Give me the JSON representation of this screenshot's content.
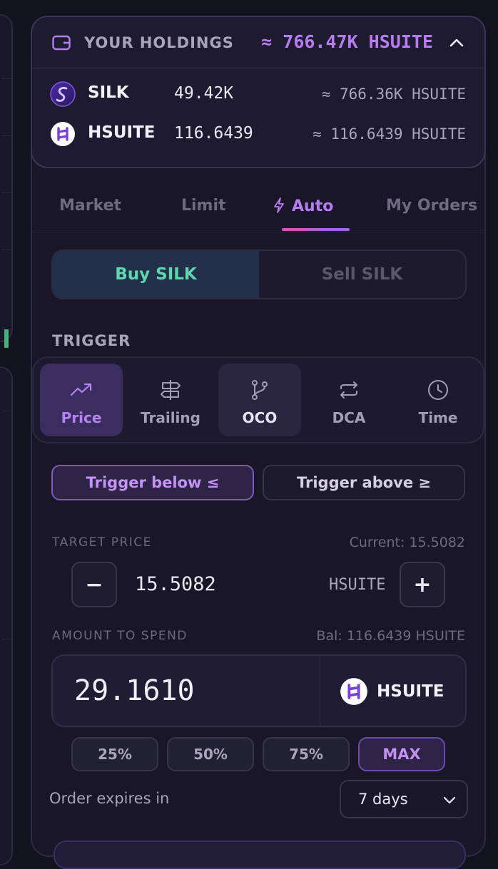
{
  "holdings": {
    "title": "YOUR HOLDINGS",
    "total": "≈ 766.47K HSUITE",
    "assets": [
      {
        "name": "SILK",
        "amount": "49.42K",
        "value": "≈ 766.36K HSUITE",
        "icon": "silk-logo-icon"
      },
      {
        "name": "HSUITE",
        "amount": "116.6439",
        "value": "≈ 116.6439 HSUITE",
        "icon": "hsuite-logo-icon"
      }
    ]
  },
  "tabs": [
    {
      "label": "Market"
    },
    {
      "label": "Limit"
    },
    {
      "label": "Auto",
      "active": true,
      "icon": "lightning-icon"
    },
    {
      "label": "My Orders"
    }
  ],
  "side": {
    "buy_label": "Buy SILK",
    "sell_label": "Sell SILK",
    "selected": "buy"
  },
  "trigger": {
    "label": "TRIGGER",
    "types": [
      {
        "label": "Price",
        "icon": "trend-up-icon",
        "active": true
      },
      {
        "label": "Trailing",
        "icon": "signpost-icon"
      },
      {
        "label": "OCO",
        "icon": "branch-icon"
      },
      {
        "label": "DCA",
        "icon": "repeat-icon"
      },
      {
        "label": "Time",
        "icon": "clock-icon"
      }
    ],
    "below_label": "Trigger below ≤",
    "above_label": "Trigger above ≥"
  },
  "target_price": {
    "label": "TARGET PRICE",
    "current": "Current: 15.5082",
    "value": "15.5082",
    "unit": "HSUITE",
    "minus": "−",
    "plus": "+"
  },
  "amount": {
    "label": "AMOUNT TO SPEND",
    "balance": "Bal: 116.6439 HSUITE",
    "value": "29.1610",
    "token": "HSUITE",
    "presets": [
      "25%",
      "50%",
      "75%",
      "MAX"
    ]
  },
  "expiry": {
    "label": "Order expires in",
    "selected": "7 days"
  },
  "colors": {
    "accent": "#b57ff3",
    "buy": "#5fd6b0",
    "panel": "#181627"
  }
}
